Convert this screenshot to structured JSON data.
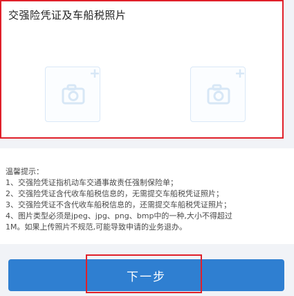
{
  "upload": {
    "title": "交强险凭证及车船税照片",
    "slots": [
      {
        "icon": "camera-add-icon"
      },
      {
        "icon": "camera-add-icon"
      }
    ]
  },
  "tips": {
    "heading": "温馨提示：",
    "lines": [
      "1、交强险凭证指机动车交通事故责任强制保险单；",
      "2、交强险凭证含代收车船税信息的，无需提交车船税凭证照片；",
      "3、交强险凭证不含代收车船税信息的，还需提交车船税凭证照片；",
      "4、图片类型必须是jpeg、jpg、png、bmp中的一种,大小不得超过",
      "1M。如果上传照片不规范,可能导致申请的业务退办。"
    ]
  },
  "footer": {
    "next_label": "下一步"
  },
  "colors": {
    "primary": "#2f7fd1",
    "highlight": "#e0202a",
    "icon": "#d7e7f6",
    "background": "#f1f3f7"
  }
}
